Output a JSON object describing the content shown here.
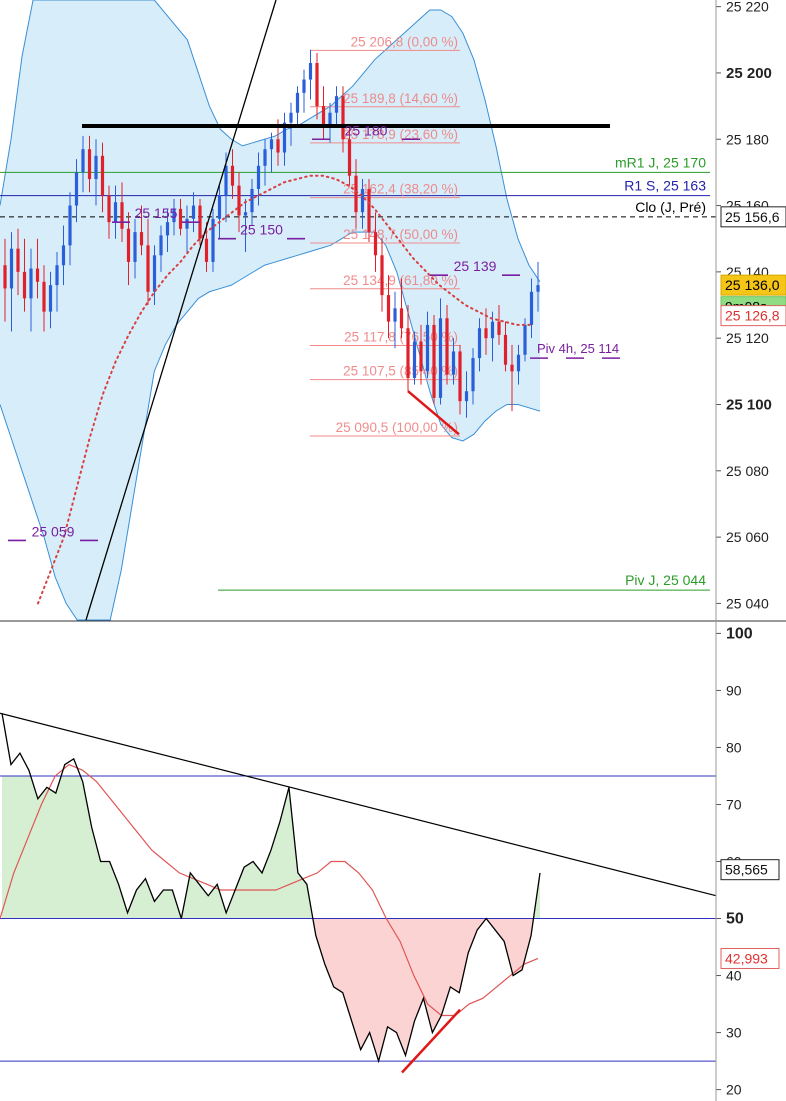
{
  "chart_data": [
    {
      "type": "candlestick",
      "panel": "price",
      "ylim": [
        25035,
        25222
      ],
      "y_ticks": [
        "25 220",
        "25 200",
        "25 180",
        "25 160",
        "25 140",
        "25 120",
        "25 100",
        "25 080",
        "25 060",
        "25 040"
      ],
      "y_ticks_bold": [
        "25 200",
        "25 100"
      ],
      "candles": [
        {
          "o": 25142,
          "h": 25150,
          "l": 25125,
          "c": 25135
        },
        {
          "o": 25135,
          "h": 25152,
          "l": 25122,
          "c": 25147
        },
        {
          "o": 25147,
          "h": 25153,
          "l": 25133,
          "c": 25140
        },
        {
          "o": 25140,
          "h": 25150,
          "l": 25128,
          "c": 25132
        },
        {
          "o": 25132,
          "h": 25147,
          "l": 25122,
          "c": 25141
        },
        {
          "o": 25141,
          "h": 25150,
          "l": 25132,
          "c": 25137
        },
        {
          "o": 25137,
          "h": 25142,
          "l": 25122,
          "c": 25128
        },
        {
          "o": 25128,
          "h": 25140,
          "l": 25123,
          "c": 25136
        },
        {
          "o": 25136,
          "h": 25146,
          "l": 25128,
          "c": 25142
        },
        {
          "o": 25142,
          "h": 25154,
          "l": 25136,
          "c": 25148
        },
        {
          "o": 25148,
          "h": 25164,
          "l": 25142,
          "c": 25160
        },
        {
          "o": 25160,
          "h": 25174,
          "l": 25155,
          "c": 25170
        },
        {
          "o": 25170,
          "h": 25181,
          "l": 25164,
          "c": 25177
        },
        {
          "o": 25177,
          "h": 25181,
          "l": 25164,
          "c": 25168
        },
        {
          "o": 25168,
          "h": 25180,
          "l": 25160,
          "c": 25175
        },
        {
          "o": 25175,
          "h": 25179,
          "l": 25158,
          "c": 25163
        },
        {
          "o": 25163,
          "h": 25166,
          "l": 25150,
          "c": 25155
        },
        {
          "o": 25155,
          "h": 25166,
          "l": 25150,
          "c": 25161
        },
        {
          "o": 25161,
          "h": 25167,
          "l": 25149,
          "c": 25153
        },
        {
          "o": 25153,
          "h": 25158,
          "l": 25136,
          "c": 25143
        },
        {
          "o": 25143,
          "h": 25156,
          "l": 25138,
          "c": 25152
        },
        {
          "o": 25152,
          "h": 25160,
          "l": 25145,
          "c": 25148
        },
        {
          "o": 25148,
          "h": 25156,
          "l": 25130,
          "c": 25134
        },
        {
          "o": 25134,
          "h": 25148,
          "l": 25130,
          "c": 25145
        },
        {
          "o": 25145,
          "h": 25154,
          "l": 25140,
          "c": 25151
        },
        {
          "o": 25151,
          "h": 25159,
          "l": 25146,
          "c": 25155
        },
        {
          "o": 25155,
          "h": 25162,
          "l": 25151,
          "c": 25159
        },
        {
          "o": 25159,
          "h": 25162,
          "l": 25151,
          "c": 25153
        },
        {
          "o": 25153,
          "h": 25160,
          "l": 25146,
          "c": 25156
        },
        {
          "o": 25156,
          "h": 25164,
          "l": 25152,
          "c": 25160
        },
        {
          "o": 25160,
          "h": 25162,
          "l": 25148,
          "c": 25150
        },
        {
          "o": 25150,
          "h": 25155,
          "l": 25140,
          "c": 25143
        },
        {
          "o": 25143,
          "h": 25159,
          "l": 25140,
          "c": 25156
        },
        {
          "o": 25156,
          "h": 25166,
          "l": 25150,
          "c": 25163
        },
        {
          "o": 25163,
          "h": 25176,
          "l": 25155,
          "c": 25172
        },
        {
          "o": 25172,
          "h": 25177,
          "l": 25162,
          "c": 25166
        },
        {
          "o": 25166,
          "h": 25170,
          "l": 25152,
          "c": 25157
        },
        {
          "o": 25157,
          "h": 25162,
          "l": 25146,
          "c": 25158
        },
        {
          "o": 25158,
          "h": 25168,
          "l": 25154,
          "c": 25165
        },
        {
          "o": 25165,
          "h": 25176,
          "l": 25160,
          "c": 25172
        },
        {
          "o": 25172,
          "h": 25180,
          "l": 25166,
          "c": 25177
        },
        {
          "o": 25177,
          "h": 25182,
          "l": 25170,
          "c": 25180
        },
        {
          "o": 25180,
          "h": 25186,
          "l": 25172,
          "c": 25176
        },
        {
          "o": 25176,
          "h": 25188,
          "l": 25172,
          "c": 25185
        },
        {
          "o": 25185,
          "h": 25191,
          "l": 25178,
          "c": 25188
        },
        {
          "o": 25188,
          "h": 25196,
          "l": 25184,
          "c": 25194
        },
        {
          "o": 25194,
          "h": 25201,
          "l": 25188,
          "c": 25198
        },
        {
          "o": 25198,
          "h": 25207,
          "l": 25192,
          "c": 25203
        },
        {
          "o": 25203,
          "h": 25206,
          "l": 25186,
          "c": 25190
        },
        {
          "o": 25190,
          "h": 25196,
          "l": 25180,
          "c": 25184
        },
        {
          "o": 25184,
          "h": 25191,
          "l": 25179,
          "c": 25188
        },
        {
          "o": 25188,
          "h": 25196,
          "l": 25184,
          "c": 25193
        },
        {
          "o": 25193,
          "h": 25196,
          "l": 25176,
          "c": 25180
        },
        {
          "o": 25180,
          "h": 25184,
          "l": 25166,
          "c": 25169
        },
        {
          "o": 25169,
          "h": 25174,
          "l": 25153,
          "c": 25158
        },
        {
          "o": 25158,
          "h": 25168,
          "l": 25153,
          "c": 25165
        },
        {
          "o": 25165,
          "h": 25168,
          "l": 25149,
          "c": 25152
        },
        {
          "o": 25152,
          "h": 25158,
          "l": 25140,
          "c": 25145
        },
        {
          "o": 25145,
          "h": 25150,
          "l": 25128,
          "c": 25133
        },
        {
          "o": 25133,
          "h": 25139,
          "l": 25120,
          "c": 25125
        },
        {
          "o": 25125,
          "h": 25134,
          "l": 25117,
          "c": 25129
        },
        {
          "o": 25129,
          "h": 25138,
          "l": 25120,
          "c": 25123
        },
        {
          "o": 25123,
          "h": 25130,
          "l": 25104,
          "c": 25108
        },
        {
          "o": 25108,
          "h": 25122,
          "l": 25106,
          "c": 25119
        },
        {
          "o": 25119,
          "h": 25124,
          "l": 25106,
          "c": 25110
        },
        {
          "o": 25110,
          "h": 25128,
          "l": 25108,
          "c": 25124
        },
        {
          "o": 25124,
          "h": 25127,
          "l": 25100,
          "c": 25102
        },
        {
          "o": 25102,
          "h": 25132,
          "l": 25100,
          "c": 25126
        },
        {
          "o": 25126,
          "h": 25130,
          "l": 25106,
          "c": 25109
        },
        {
          "o": 25109,
          "h": 25120,
          "l": 25106,
          "c": 25116
        },
        {
          "o": 25116,
          "h": 25118,
          "l": 25097,
          "c": 25101
        },
        {
          "o": 25101,
          "h": 25110,
          "l": 25096,
          "c": 25104
        },
        {
          "o": 25104,
          "h": 25117,
          "l": 25100,
          "c": 25114
        },
        {
          "o": 25114,
          "h": 25126,
          "l": 25110,
          "c": 25123
        },
        {
          "o": 25123,
          "h": 25129,
          "l": 25115,
          "c": 25120
        },
        {
          "o": 25120,
          "h": 25128,
          "l": 25113,
          "c": 25125
        },
        {
          "o": 25125,
          "h": 25130,
          "l": 25118,
          "c": 25121
        },
        {
          "o": 25121,
          "h": 25125,
          "l": 25110,
          "c": 25112
        },
        {
          "o": 25112,
          "h": 25118,
          "l": 25098,
          "c": 25110
        },
        {
          "o": 25110,
          "h": 25118,
          "l": 25106,
          "c": 25115
        },
        {
          "o": 25115,
          "h": 25126,
          "l": 25113,
          "c": 25124
        },
        {
          "o": 25124,
          "h": 25138,
          "l": 25120,
          "c": 25134
        },
        {
          "o": 25134,
          "h": 25143,
          "l": 25128,
          "c": 25136
        }
      ],
      "bollinger_upper": [
        25160,
        25180,
        25205,
        25222,
        25222,
        25222,
        25222,
        25222,
        25222,
        25222,
        25222,
        25222,
        25222,
        25222,
        25222,
        25218,
        25214,
        25210,
        25200,
        25190,
        25183,
        25180,
        25178,
        25179,
        25180,
        25181,
        25183,
        25184,
        25186,
        25188,
        25190,
        25193,
        25196,
        25200,
        25204,
        25207,
        25210,
        25213,
        25216,
        25219,
        25219,
        25217,
        25212,
        25204,
        25192,
        25178,
        25162,
        25150,
        25142,
        25137
      ],
      "bollinger_lower": [
        25100,
        25090,
        25080,
        25070,
        25060,
        25048,
        25040,
        25035,
        25035,
        25035,
        25035,
        25050,
        25070,
        25090,
        25110,
        25118,
        25124,
        25128,
        25132,
        25134,
        25135,
        25136,
        25138,
        25140,
        25142,
        25143,
        25144,
        25145,
        25146,
        25147,
        25148,
        25150,
        25152,
        25152,
        25152,
        25148,
        25140,
        25128,
        25116,
        25104,
        25094,
        25090,
        25089,
        25091,
        25095,
        25098,
        25100,
        25100,
        25099,
        25098
      ],
      "moving_average": [
        25040,
        25050,
        25060,
        25075,
        25090,
        25103,
        25113,
        25121,
        25128,
        25134,
        25139,
        25143,
        25148,
        25152,
        25155,
        25158,
        25161,
        25163,
        25165,
        25167,
        25168,
        25169,
        25169,
        25168,
        25166,
        25163,
        25159,
        25154,
        25149,
        25144,
        25140,
        25136,
        25133,
        25130,
        25128,
        25126,
        25125,
        25124,
        25124
      ],
      "fib_levels": [
        {
          "label": "25 206,8 (0,00 %)",
          "value": 25206.8
        },
        {
          "label": "25 189,8 (14,60 %)",
          "value": 25189.8
        },
        {
          "label": "25 178,9 (23,60 %)",
          "value": 25178.9
        },
        {
          "label": "25 162,4 (38,20 %)",
          "value": 25162.4
        },
        {
          "label": "25 148,7 (50,00 %)",
          "value": 25148.7
        },
        {
          "label": "25 134,9 (61,80 %)",
          "value": 25134.9
        },
        {
          "label": "25 117,8 (76,50 %)",
          "value": 25117.8
        },
        {
          "label": "25 107,5 (85,40 %)",
          "value": 25107.5
        },
        {
          "label": "25 090,5 (100,00 %)",
          "value": 25090.5
        }
      ],
      "pivot_labels": [
        {
          "label": "25 155",
          "value": 25155
        },
        {
          "label": "25 150",
          "value": 25150
        },
        {
          "label": "25 180",
          "value": 25180
        },
        {
          "label": "25 139",
          "value": 25139
        },
        {
          "label": "25 059",
          "value": 25059
        }
      ],
      "horizontal_levels": [
        {
          "label": "mR1 J, 25 170",
          "value": 25170,
          "color": "#2a9d2a"
        },
        {
          "label": "R1 S, 25 163",
          "value": 25163,
          "color": "#2222aa"
        },
        {
          "label": "Clo (J, Pré)",
          "value": 25156.6,
          "color": "#000000"
        },
        {
          "label": "Piv 4h, 25 114",
          "value": 25114,
          "color": "#7a1fa2"
        },
        {
          "label": "Piv J, 25 044",
          "value": 25044,
          "color": "#2a9d2a"
        }
      ],
      "resistance_line": 25184,
      "bearish_divergence": {
        "from": 25104,
        "to": 25091
      },
      "price_tags": [
        {
          "label": "25 156,6",
          "value": 25156.6,
          "style": "outline-black"
        },
        {
          "label": "25 136,0",
          "value": 25136,
          "style": "gold"
        },
        {
          "label": "9m08s",
          "value": 25129.5,
          "style": "green"
        },
        {
          "label": "25 126,8",
          "value": 25126.8,
          "style": "outline-red"
        }
      ]
    },
    {
      "type": "line",
      "panel": "oscillator",
      "ylim": [
        18,
        102
      ],
      "y_ticks": [
        "100",
        "90",
        "80",
        "70",
        "60",
        "50",
        "40",
        "30",
        "20"
      ],
      "y_ticks_bold": [
        "100",
        "50"
      ],
      "levels": [
        75,
        50,
        25
      ],
      "oscillator": [
        86,
        77,
        79,
        76,
        71,
        73,
        72,
        77,
        78,
        74,
        66,
        60,
        60,
        56,
        51,
        55,
        57,
        53,
        55,
        55,
        50,
        58,
        56,
        54,
        56,
        51,
        55,
        59,
        60,
        58,
        62,
        67,
        73,
        58,
        56,
        47,
        42,
        38,
        37,
        32,
        27,
        30,
        25,
        31,
        30,
        26,
        32,
        36,
        30,
        33,
        38,
        37,
        44,
        48,
        50,
        48,
        46,
        40,
        41,
        47,
        58
      ],
      "signal_ma": [
        50,
        58,
        64,
        70,
        75,
        77,
        76,
        74,
        71,
        68,
        65,
        62,
        60,
        58,
        57,
        56,
        55,
        55,
        55,
        55,
        55,
        56,
        57,
        58,
        60,
        60,
        58,
        55,
        50,
        46,
        40,
        35,
        33,
        33,
        35,
        36,
        38,
        40,
        42,
        43
      ],
      "trendline": {
        "from": 86,
        "to": 54
      },
      "bullish_divergence": {
        "from": 23,
        "to": 34
      },
      "value_tags": [
        {
          "label": "58,565",
          "value": 58.565,
          "style": "outline-black"
        },
        {
          "label": "42,993",
          "value": 42.993,
          "style": "outline-red"
        }
      ]
    }
  ]
}
